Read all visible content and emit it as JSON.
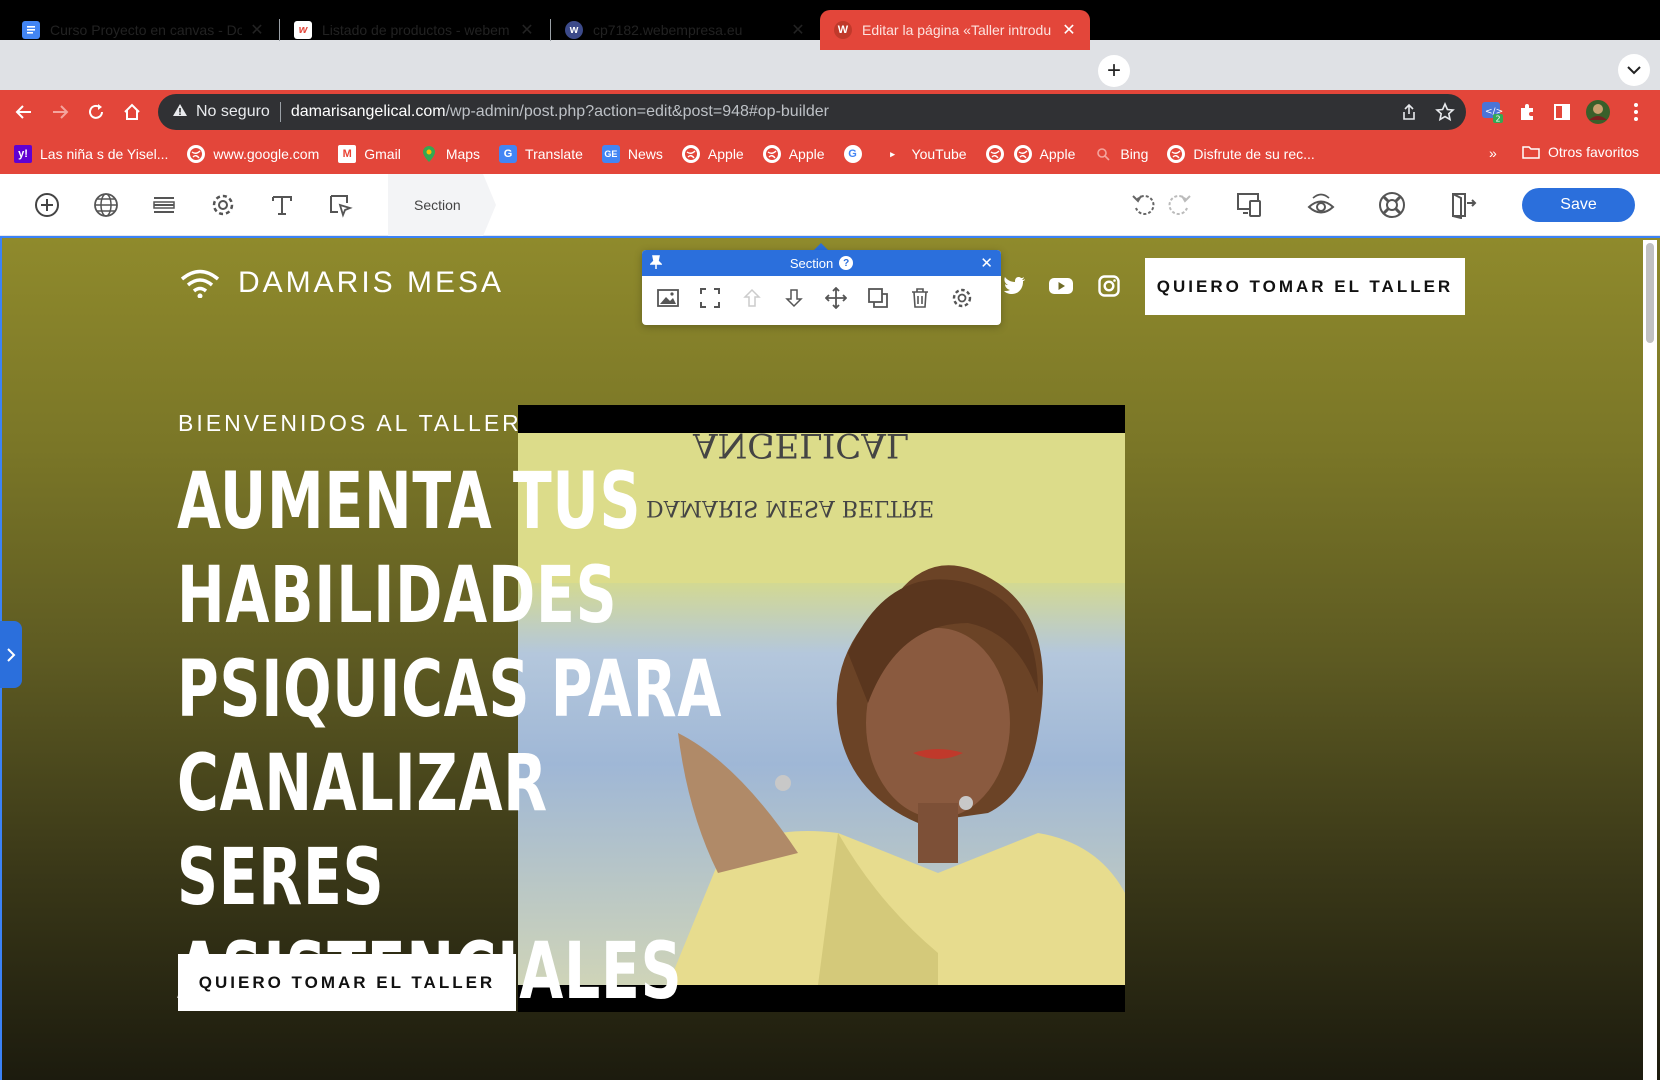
{
  "browser": {
    "tabs": [
      {
        "title": "Curso Proyecto en canvas - Do",
        "active": false,
        "favicon_color": "#4285f4",
        "icon": "docs-icon"
      },
      {
        "title": "Listado de productos - webem",
        "active": false,
        "favicon_color": "#ffffff",
        "icon": "webempresa-icon"
      },
      {
        "title": "cp7182.webempresa.eu",
        "active": false,
        "favicon_color": "#3c4a8a",
        "icon": "cpanel-icon"
      },
      {
        "title": "Editar la página «Taller introdu",
        "active": true,
        "favicon_color": "#c0392b",
        "icon": "wordpress-icon"
      }
    ],
    "address": {
      "security_label": "No seguro",
      "host": "damarisangelical.com",
      "path": "/wp-admin/post.php?action=edit&post=948#op-builder"
    },
    "bookmarks": [
      {
        "label": "Las niña s de Yisel...",
        "icon": "yahoo-icon",
        "color": "#6001d2"
      },
      {
        "label": "www.google.com",
        "icon": "globe-icon",
        "color": "#ffffff"
      },
      {
        "label": "Gmail",
        "icon": "gmail-icon",
        "color": "#ffffff"
      },
      {
        "label": "Maps",
        "icon": "maps-icon",
        "color": "#34a853"
      },
      {
        "label": "Translate",
        "icon": "translate-icon",
        "color": "#4285f4"
      },
      {
        "label": "News",
        "icon": "news-icon",
        "color": "#4285f4"
      },
      {
        "label": "Apple",
        "icon": "globe-icon",
        "color": "#ffffff"
      },
      {
        "label": "Apple",
        "icon": "globe-icon",
        "color": "#ffffff"
      },
      {
        "label": "",
        "icon": "google-icon",
        "color": "#ffffff"
      },
      {
        "label": "YouTube",
        "icon": "youtube-icon",
        "color": "#ffffff"
      },
      {
        "label": "",
        "icon": "globe-icon",
        "color": "#ffffff"
      },
      {
        "label": "Apple",
        "icon": "globe-icon",
        "color": "#ffffff"
      },
      {
        "label": "Bing",
        "icon": "search-icon",
        "color": "#ffffff"
      },
      {
        "label": "Disfrute de su rec...",
        "icon": "globe-icon",
        "color": "#ffffff"
      }
    ],
    "bookmarks_more": "»",
    "other_bookmarks": "Otros favoritos",
    "accent": "#e3463a"
  },
  "builder": {
    "breadcrumb": "Section",
    "save_label": "Save",
    "accent": "#2b6fdc"
  },
  "popup": {
    "title": "Section",
    "help": "?",
    "close": "✕"
  },
  "page": {
    "logo_text": "DAMARIS MESA",
    "header_cta": "QUIERO TOMAR EL TALLER",
    "welcome": "BIENVENIDOS AL TALLER:",
    "headline": "AUMENTA TUS HABILIDADES PSIQUICAS PARA CANALIZAR SERES ASISTENCIALES",
    "hero_cta": "QUIERO TOMAR EL TALLER",
    "photo_text_1": "ANGELICAL",
    "photo_text_2": "DAMARIS MESA BELTRE",
    "social": [
      "twitter-icon",
      "youtube-icon",
      "instagram-icon"
    ]
  }
}
